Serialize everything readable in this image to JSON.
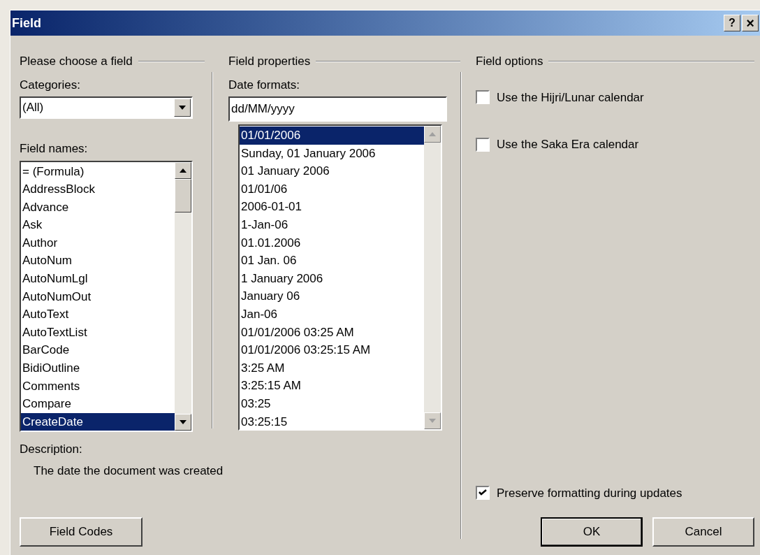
{
  "window": {
    "title": "Field",
    "help_button": "?",
    "close_button": "×"
  },
  "choose_group": {
    "title": "Please choose a field",
    "categories_label": "Categories:",
    "categories_value": "(All)",
    "field_names_label": "Field names:",
    "field_names": [
      {
        "label": "= (Formula)",
        "selected": false
      },
      {
        "label": "AddressBlock",
        "selected": false
      },
      {
        "label": "Advance",
        "selected": false
      },
      {
        "label": "Ask",
        "selected": false
      },
      {
        "label": "Author",
        "selected": false
      },
      {
        "label": "AutoNum",
        "selected": false
      },
      {
        "label": "AutoNumLgl",
        "selected": false
      },
      {
        "label": "AutoNumOut",
        "selected": false
      },
      {
        "label": "AutoText",
        "selected": false
      },
      {
        "label": "AutoTextList",
        "selected": false
      },
      {
        "label": "BarCode",
        "selected": false
      },
      {
        "label": "BidiOutline",
        "selected": false
      },
      {
        "label": "Comments",
        "selected": false
      },
      {
        "label": "Compare",
        "selected": false
      },
      {
        "label": "CreateDate",
        "selected": true
      }
    ],
    "description_label": "Description:",
    "description": "The date the document was created"
  },
  "properties_group": {
    "title": "Field properties",
    "date_formats_label": "Date formats:",
    "date_format_value": "dd/MM/yyyy",
    "date_formats": [
      {
        "label": "01/01/2006",
        "selected": true
      },
      {
        "label": "Sunday, 01 January 2006",
        "selected": false
      },
      {
        "label": "01 January 2006",
        "selected": false
      },
      {
        "label": "01/01/06",
        "selected": false
      },
      {
        "label": "2006-01-01",
        "selected": false
      },
      {
        "label": "1-Jan-06",
        "selected": false
      },
      {
        "label": "01.01.2006",
        "selected": false
      },
      {
        "label": "01 Jan. 06",
        "selected": false
      },
      {
        "label": "1 January 2006",
        "selected": false
      },
      {
        "label": "January 06",
        "selected": false
      },
      {
        "label": "Jan-06",
        "selected": false
      },
      {
        "label": "01/01/2006 03:25 AM",
        "selected": false
      },
      {
        "label": "01/01/2006 03:25:15 AM",
        "selected": false
      },
      {
        "label": "3:25 AM",
        "selected": false
      },
      {
        "label": "3:25:15 AM",
        "selected": false
      },
      {
        "label": "03:25",
        "selected": false
      },
      {
        "label": "03:25:15",
        "selected": false
      }
    ]
  },
  "options_group": {
    "title": "Field options",
    "options": [
      {
        "label": "Use the Hijri/Lunar calendar",
        "checked": false
      },
      {
        "label": "Use the Saka Era calendar",
        "checked": false
      }
    ],
    "preserve": {
      "label": "Preserve formatting during updates",
      "checked": true
    }
  },
  "buttons": {
    "field_codes": "Field Codes",
    "ok": "OK",
    "cancel": "Cancel"
  }
}
